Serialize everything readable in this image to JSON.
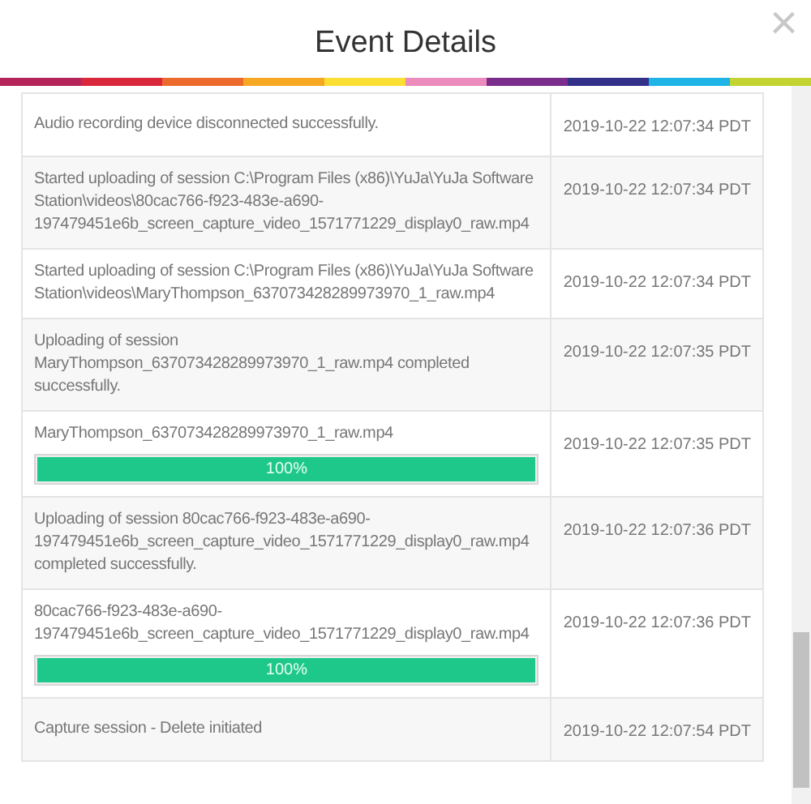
{
  "dialog": {
    "title": "Event Details",
    "close_label": "×"
  },
  "events": [
    {
      "message": "Audio recording device disconnected successfully.",
      "time": "2019-10-22 12:07:34 PDT"
    },
    {
      "message": "Started uploading of session C:\\Program Files (x86)\\YuJa\\YuJa Software Station\\videos\\80cac766-f923-483e-a690-197479451e6b_screen_capture_video_1571771229_display0_raw.mp4",
      "time": "2019-10-22 12:07:34 PDT"
    },
    {
      "message": "Started uploading of session C:\\Program Files (x86)\\YuJa\\YuJa Software Station\\videos\\MaryThompson_637073428289973970_1_raw.mp4",
      "time": "2019-10-22 12:07:34 PDT"
    },
    {
      "message": "Uploading of session MaryThompson_637073428289973970_1_raw.mp4 completed successfully.",
      "time": "2019-10-22 12:07:35 PDT"
    },
    {
      "message": "MaryThompson_637073428289973970_1_raw.mp4",
      "time": "2019-10-22 12:07:35 PDT",
      "progress": {
        "level": 1,
        "label": "100%"
      }
    },
    {
      "message": "Uploading of session 80cac766-f923-483e-a690-197479451e6b_screen_capture_video_1571771229_display0_raw.mp4 completed successfully.",
      "time": "2019-10-22 12:07:36 PDT"
    },
    {
      "message": "80cac766-f923-483e-a690-197479451e6b_screen_capture_video_1571771229_display0_raw.mp4",
      "time": "2019-10-22 12:07:36 PDT",
      "progress": {
        "level": 1,
        "label": "100%"
      }
    },
    {
      "message": "Capture session - Delete initiated",
      "time": "2019-10-22 12:07:54 PDT"
    }
  ]
}
